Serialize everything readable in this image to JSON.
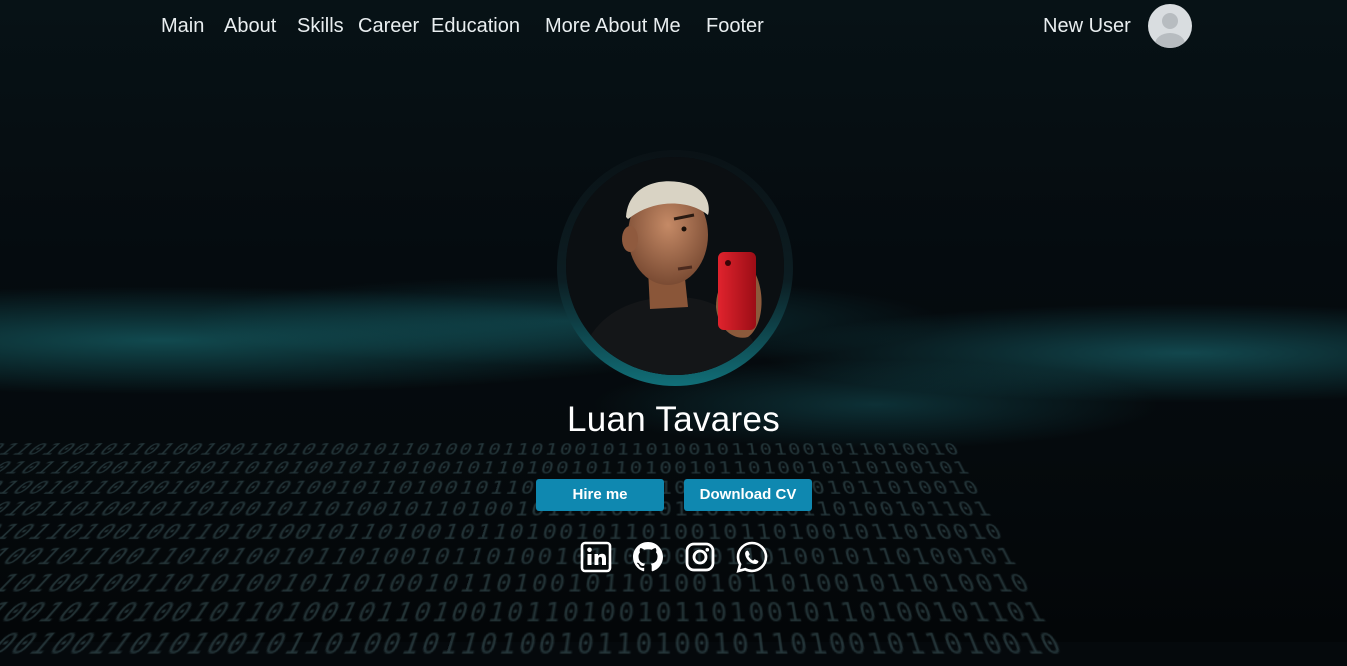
{
  "nav": {
    "items": [
      {
        "label": "Main"
      },
      {
        "label": "About"
      },
      {
        "label": "Skills"
      },
      {
        "label": "Career"
      },
      {
        "label": "Education"
      },
      {
        "label": "More About Me"
      },
      {
        "label": "Footer"
      }
    ],
    "user_label": "New User",
    "user_avatar_icon": "user-avatar-icon"
  },
  "hero": {
    "name": "Luan Tavares",
    "hire_label": "Hire me",
    "download_label": "Download CV",
    "social": [
      {
        "icon": "linkedin-icon"
      },
      {
        "icon": "github-icon"
      },
      {
        "icon": "instagram-icon"
      },
      {
        "icon": "whatsapp-icon"
      }
    ]
  },
  "colors": {
    "button": "#0f88b0",
    "accent_teal": "#116f78",
    "background": "#05090c"
  }
}
